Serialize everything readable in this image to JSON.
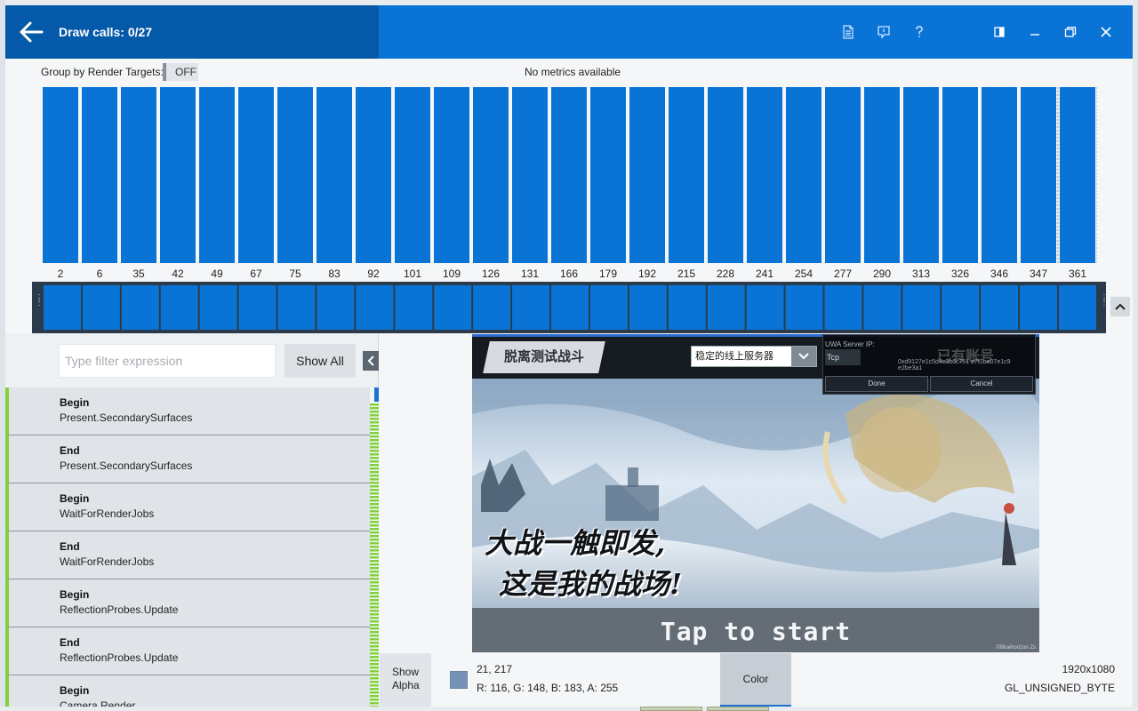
{
  "window": {
    "title": "Draw calls: 0/27",
    "colors": {
      "title_bar": "#0a74d6",
      "title_left": "#0559a9",
      "accent_green": "#82d23a"
    }
  },
  "toolbar": {
    "icons": [
      "document-icon",
      "feedback-icon",
      "help-icon",
      "panel-toggle-icon",
      "minimize-icon",
      "restore-icon",
      "close-icon"
    ]
  },
  "metrics_row": {
    "group_label": "Group by Render Targets:",
    "group_toggle": "OFF",
    "status": "No metrics available"
  },
  "chart_data": {
    "type": "bar",
    "categories": [
      "2",
      "6",
      "35",
      "42",
      "49",
      "67",
      "75",
      "83",
      "92",
      "101",
      "109",
      "126",
      "131",
      "166",
      "179",
      "192",
      "215",
      "228",
      "241",
      "254",
      "277",
      "290",
      "313",
      "326",
      "346",
      "347",
      "361"
    ],
    "values": [
      1,
      1,
      1,
      1,
      1,
      1,
      1,
      1,
      1,
      1,
      1,
      1,
      1,
      1,
      1,
      1,
      1,
      1,
      1,
      1,
      1,
      1,
      1,
      1,
      1,
      1,
      1
    ],
    "title": "",
    "xlabel": "",
    "ylabel": "",
    "ylim": [
      0,
      1
    ],
    "bar_color": "#0a74d6",
    "grid": false
  },
  "timeline": {
    "segments": 27,
    "color": "#0a74d6"
  },
  "filter": {
    "placeholder": "Type filter expression",
    "show_all_label": "Show All"
  },
  "events": [
    {
      "type": "Begin",
      "name": "Present.SecondarySurfaces"
    },
    {
      "type": "End",
      "name": "Present.SecondarySurfaces"
    },
    {
      "type": "Begin",
      "name": "WaitForRenderJobs"
    },
    {
      "type": "End",
      "name": "WaitForRenderJobs"
    },
    {
      "type": "Begin",
      "name": "ReflectionProbes.Update"
    },
    {
      "type": "End",
      "name": "ReflectionProbes.Update"
    },
    {
      "type": "Begin",
      "name": "Camera.Render"
    }
  ],
  "game": {
    "exit_battle": "脱离测试战斗",
    "server_select": "稳定的线上服务器",
    "server_label": "UWA Server IP:",
    "server_faint": "已有账号",
    "protocol": "Tcp",
    "server_address": "0xd9127e1c5d4c3b6c751 e7f2be07e1c9 e2be3a1",
    "done": "Done",
    "cancel": "Cancel",
    "slogan_line1": "大战一触即发,",
    "slogan_line2": "这是我的战场!",
    "tap_to_start": "Tap to start",
    "watermark": "©Bluehorizon Zs"
  },
  "footer": {
    "show_alpha": "Show Alpha",
    "pixel_coords": "21, 217",
    "pixel_rgba": "R: 116, G: 148, B: 183, A: 255",
    "swatch_color": "#7494b7",
    "color_button": "Color",
    "resolution": "1920x1080",
    "format": "GL_UNSIGNED_BYTE"
  }
}
